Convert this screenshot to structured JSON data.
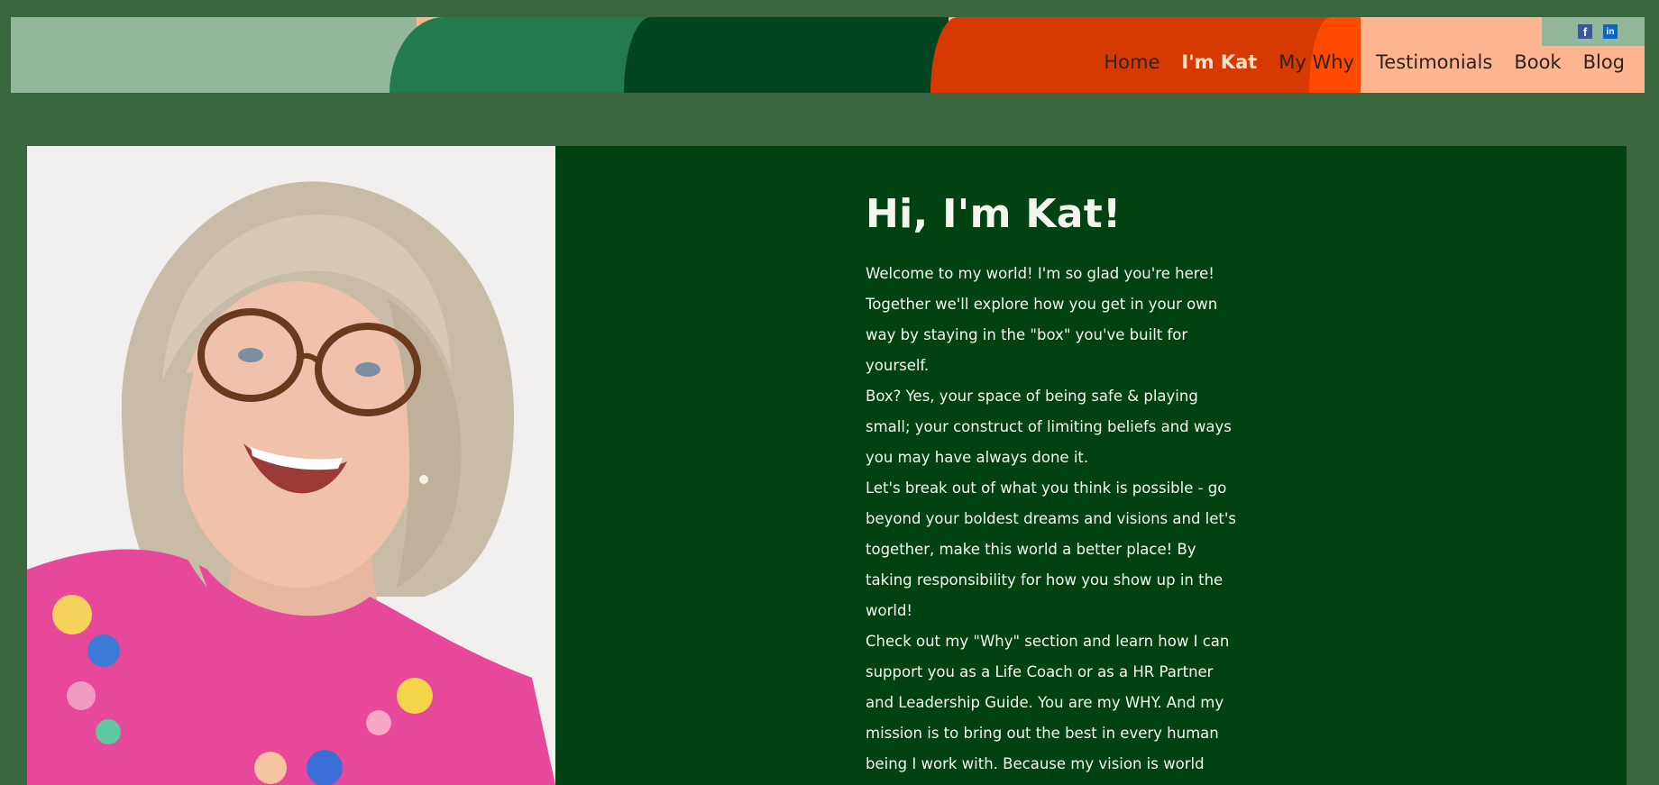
{
  "nav": {
    "items": [
      {
        "label": "Home",
        "active": false
      },
      {
        "label": "I'm Kat",
        "active": true
      },
      {
        "label": "My Why",
        "active": false
      },
      {
        "label": "Testimonials",
        "active": false
      },
      {
        "label": "Book",
        "active": false
      },
      {
        "label": "Blog",
        "active": false
      }
    ]
  },
  "social": {
    "facebook_icon": "f",
    "linkedin_icon": "in"
  },
  "colors": {
    "page_bg": "#3a6640",
    "panel_bg": "#004211",
    "band_sage": "#94b79b",
    "band_green": "#237a4e",
    "band_dark": "#004420",
    "band_red": "#d63a00",
    "band_orange": "#ff4a00",
    "band_peach": "#ffb590"
  },
  "main": {
    "title": "Hi, I'm Kat!",
    "paragraphs": [
      "Welcome to my world! I'm so glad you're here! Together we'll explore how you get in your own way by staying in the \"box\" you've built for yourself.",
      "Box? Yes, your space of being safe & playing small; your construct of limiting beliefs and ways you may have always done it.",
      "Let's break out of what you think is possible - go beyond your boldest dreams and visions and let's together, make this world a better place! By taking responsibility for how you show up in the world!",
      "Check out my \"Why\" section and learn how I can support you as a Life Coach or as a HR Partner and Leadership Guide. You are my WHY. And my mission is to bring out the best in every human being I work with. Because my vision is world peace and happiness. If you think right now"
    ]
  }
}
